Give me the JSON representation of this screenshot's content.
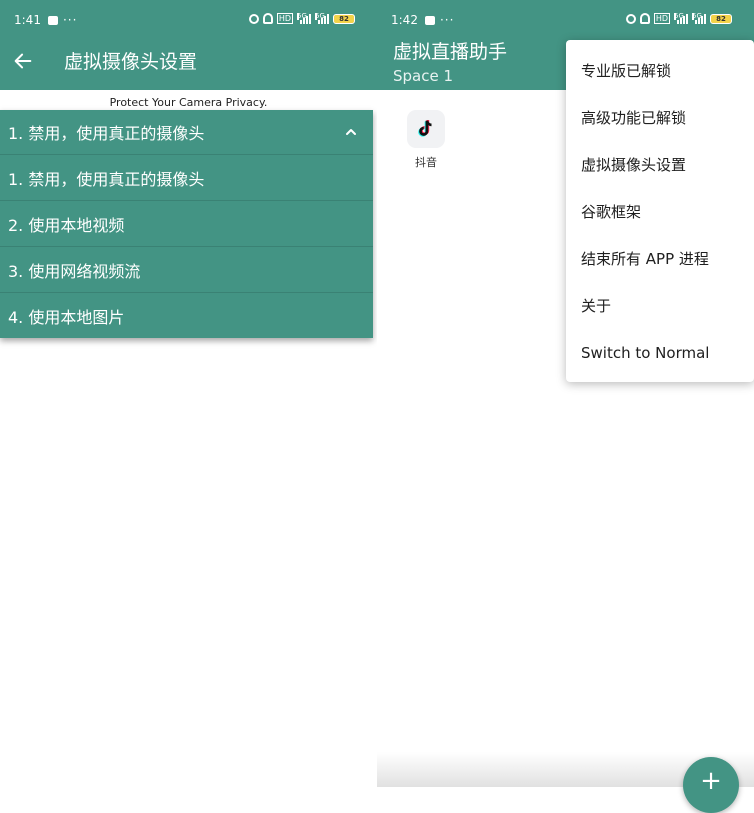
{
  "left": {
    "status": {
      "time": "1:41",
      "more": "···",
      "battery": "82"
    },
    "title": "虚拟摄像头设置",
    "privacy_text": "Protect Your Camera Privacy.",
    "dropdown": {
      "selected": "1. 禁用，使用真正的摄像头",
      "options": [
        "1. 禁用，使用真正的摄像头",
        "2. 使用本地视频",
        "3. 使用网络视频流",
        "4. 使用本地图片"
      ]
    }
  },
  "right": {
    "status": {
      "time": "1:42",
      "more": "···",
      "battery": "82"
    },
    "title": "虚拟直播助手",
    "subtitle": "Space 1",
    "apps": [
      {
        "label": "抖音",
        "icon": "tiktok-icon"
      }
    ],
    "menu": [
      "专业版已解锁",
      "高级功能已解锁",
      "虚拟摄像头设置",
      "谷歌框架",
      "结束所有 APP 进程",
      "关于",
      "Switch to Normal"
    ],
    "fab_icon": "+"
  },
  "colors": {
    "primary": "#439484",
    "menu_bg": "#ffffff",
    "text": "#202020"
  },
  "icons": [
    "back-arrow-icon",
    "chevron-up-icon",
    "add-icon",
    "tiktok-icon",
    "battery-icon",
    "signal-icon",
    "alarm-off-icon",
    "hotspot-icon"
  ]
}
